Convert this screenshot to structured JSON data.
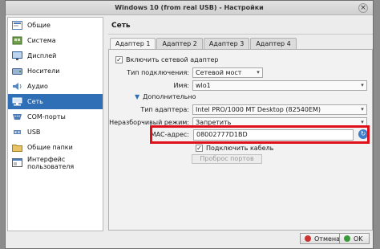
{
  "window": {
    "title": "Windows 10 (from real USB) - Настройки",
    "close_glyph": "×"
  },
  "sidebar": {
    "items": [
      {
        "label": "Общие",
        "icon": "general-icon"
      },
      {
        "label": "Система",
        "icon": "system-icon"
      },
      {
        "label": "Дисплей",
        "icon": "display-icon"
      },
      {
        "label": "Носители",
        "icon": "storage-icon"
      },
      {
        "label": "Аудио",
        "icon": "audio-icon"
      },
      {
        "label": "Сеть",
        "icon": "network-icon",
        "selected": true
      },
      {
        "label": "COM-порты",
        "icon": "serial-ports-icon"
      },
      {
        "label": "USB",
        "icon": "usb-icon"
      },
      {
        "label": "Общие папки",
        "icon": "shared-folders-icon"
      },
      {
        "label": "Интерфейс пользователя",
        "icon": "user-interface-icon"
      }
    ]
  },
  "main": {
    "section_title": "Сеть",
    "tabs": [
      {
        "label": "Адаптер 1",
        "active": true
      },
      {
        "label": "Адаптер 2"
      },
      {
        "label": "Адаптер 3"
      },
      {
        "label": "Адаптер 4"
      }
    ],
    "enable_adapter": {
      "label": "Включить сетевой адаптер",
      "checked": true
    },
    "attachment": {
      "label": "Тип подключения:",
      "value": "Сетевой мост"
    },
    "name": {
      "label": "Имя:",
      "value": "wlo1"
    },
    "advanced": {
      "label": "Дополнительно"
    },
    "adapter_type": {
      "label": "Тип адаптера:",
      "value": "Intel PRO/1000 MT Desktop (82540EM)"
    },
    "promiscuous": {
      "label": "Неразборчивый режим:",
      "value": "Запретить"
    },
    "mac": {
      "label": "MAC-адрес:",
      "value": "08002777D1BD"
    },
    "cable": {
      "label": "Подключить кабель",
      "checked": true
    },
    "port_forwarding": {
      "label": "Проброс портов"
    }
  },
  "footer": {
    "cancel_label": "Отмена",
    "ok_label": "OK"
  },
  "colors": {
    "selection": "#2f6fb5",
    "highlight_box": "#e0101a",
    "accent": "#3d7fc9"
  }
}
